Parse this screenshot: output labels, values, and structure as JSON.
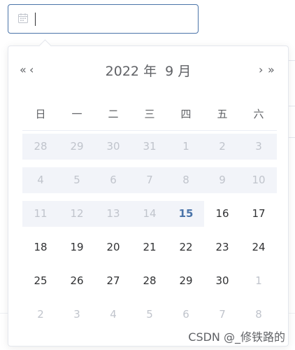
{
  "input": {
    "value": "",
    "placeholder": ""
  },
  "calendar": {
    "year": "2022",
    "year_suffix": "年",
    "month": "9",
    "month_suffix": "月",
    "nav": {
      "prev_year": "«",
      "prev_month": "‹",
      "next_month": "›",
      "next_year": "»"
    },
    "weekdays": [
      "日",
      "一",
      "二",
      "三",
      "四",
      "五",
      "六"
    ],
    "weeks": [
      [
        "28",
        "29",
        "30",
        "31",
        "1",
        "2",
        "3"
      ],
      [
        "4",
        "5",
        "6",
        "7",
        "8",
        "9",
        "10"
      ],
      [
        "11",
        "12",
        "13",
        "14",
        "15",
        "16",
        "17"
      ],
      [
        "18",
        "19",
        "20",
        "21",
        "22",
        "23",
        "24"
      ],
      [
        "25",
        "26",
        "27",
        "28",
        "29",
        "30",
        "1"
      ],
      [
        "2",
        "3",
        "4",
        "5",
        "6",
        "7",
        "8"
      ]
    ],
    "today": "15",
    "colors": {
      "accent": "#4b74a9",
      "disabled_bg": "#f2f4f9",
      "muted": "#c0c4cc",
      "text": "#303133"
    }
  },
  "watermark": "CSDN @_修铁路的"
}
